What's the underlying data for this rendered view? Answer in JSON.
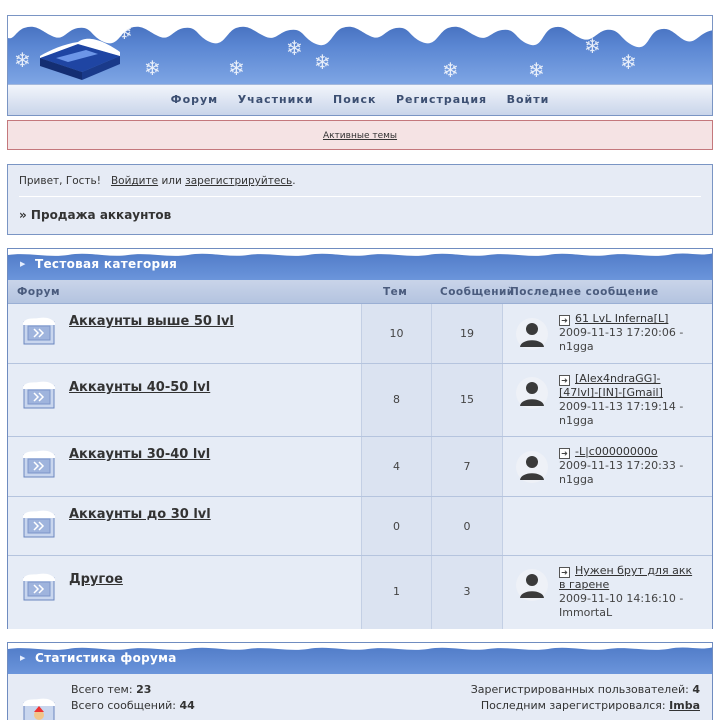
{
  "nav": {
    "items": [
      "Форум",
      "Участники",
      "Поиск",
      "Регистрация",
      "Войти"
    ]
  },
  "notice": {
    "active_topics": "Активные темы"
  },
  "welcome": {
    "greeting": "Привет, Гость!",
    "login_link": "Войдите",
    "or_text": "или",
    "register_link": "зарегистрируйтесь",
    "period": ".",
    "breadcrumb": "» Продажа аккаунтов"
  },
  "category": {
    "title": "Тестовая категория",
    "columns": {
      "forum": "Форум",
      "topics": "Тем",
      "posts": "Сообщений",
      "last_post": "Последнее сообщение"
    },
    "forums": [
      {
        "name": "Аккаунты выше 50 lvl",
        "topics": "10",
        "posts": "19",
        "last": {
          "title": "61 LvL Inferna[L]",
          "date": "2009-11-13 17:20:06",
          "author": "n1gga"
        }
      },
      {
        "name": "Аккаунты 40-50 lvl",
        "topics": "8",
        "posts": "15",
        "last": {
          "title": "[Alex4ndraGG]-[47lvl]-[IN]-[Gmail]",
          "date": "2009-11-13 17:19:14",
          "author": "n1gga"
        }
      },
      {
        "name": "Аккаунты 30-40 lvl",
        "topics": "4",
        "posts": "7",
        "last": {
          "title": "-L|c00000000o",
          "date": "2009-11-13 17:20:33",
          "author": "n1gga"
        }
      },
      {
        "name": "Аккаунты до 30 lvl",
        "topics": "0",
        "posts": "0",
        "last": null
      },
      {
        "name": "Другое",
        "topics": "1",
        "posts": "3",
        "last": {
          "title": "Нужен брут для акк в гарене",
          "date": "2009-11-10 14:16:10",
          "author": "ImmortaL"
        }
      }
    ]
  },
  "stats": {
    "title": "Статистика форума",
    "total_topics_label": "Всего тем:",
    "total_topics": "23",
    "total_posts_label": "Всего сообщений:",
    "total_posts": "44",
    "registered_label": "Зарегистрированных пользователей:",
    "registered": "4",
    "last_registered_label": "Последним зарегистрировался:",
    "last_registered": "Imba"
  },
  "colors": {
    "header_blue": "#5b87d3",
    "border_blue": "#7a95c4",
    "notice_bg": "#f5e3e4",
    "notice_border": "#c4787c"
  }
}
